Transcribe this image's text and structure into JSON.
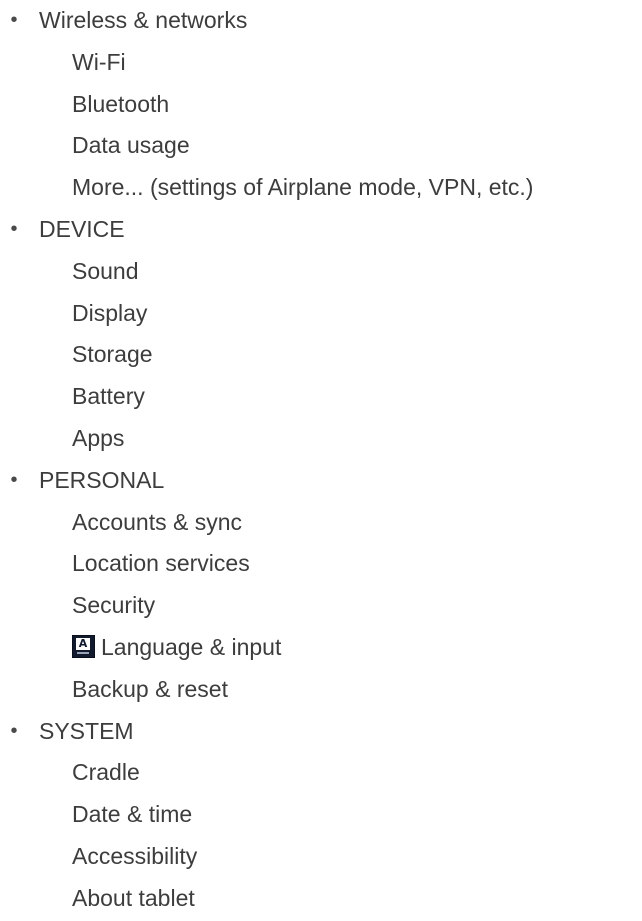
{
  "sections": [
    {
      "label": "Wireless & networks",
      "items": [
        "Wi-Fi",
        "Bluetooth",
        "Data usage",
        "More... (settings of Airplane mode, VPN, etc.)"
      ]
    },
    {
      "label": "DEVICE",
      "items": [
        "Sound",
        "Display",
        "Storage",
        "Battery",
        "Apps"
      ]
    },
    {
      "label": "PERSONAL",
      "items": [
        "Accounts & sync",
        "Location services",
        "Security",
        "Language & input",
        "Backup & reset"
      ]
    },
    {
      "label": "SYSTEM",
      "items": [
        "Cradle",
        "Date & time",
        "Accessibility",
        "About tablet"
      ]
    }
  ],
  "icons": {
    "language_input": "language-keyboard-icon",
    "language_glyph": "A"
  },
  "colors": {
    "text": "#3d3d3d",
    "icon_background": "#121a2e"
  }
}
